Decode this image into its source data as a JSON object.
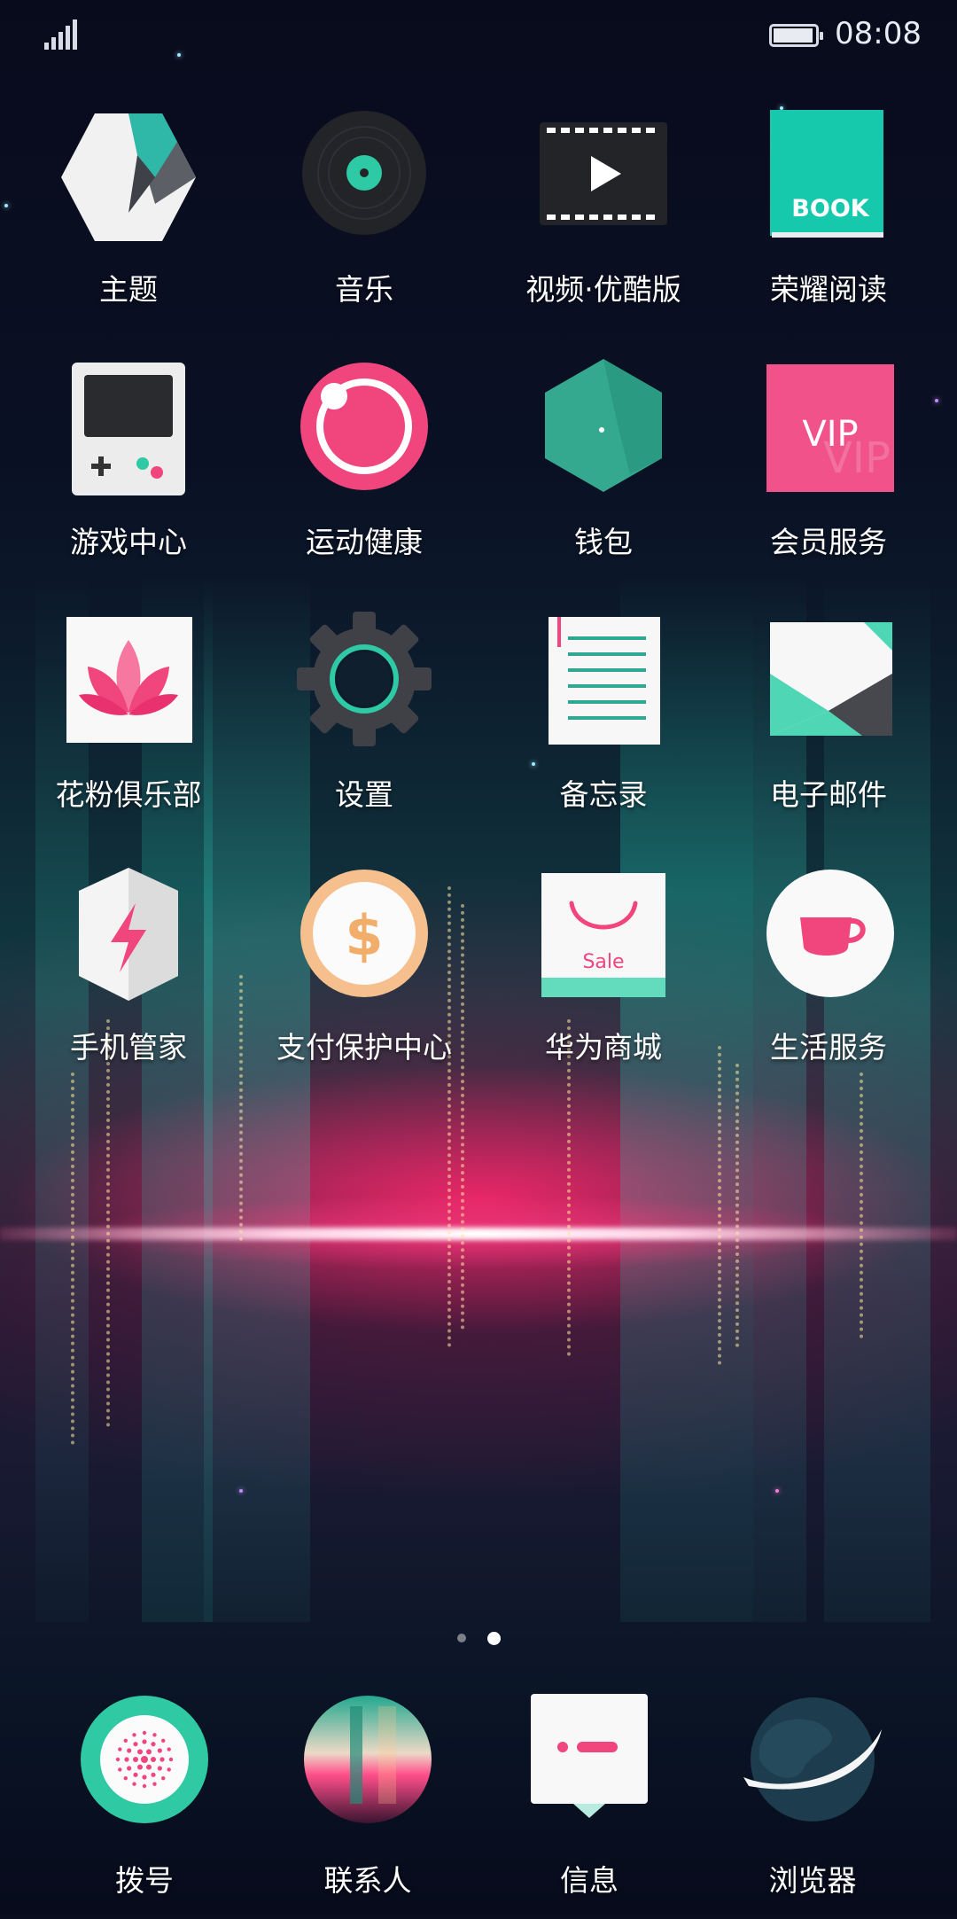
{
  "status_bar": {
    "time": "08:08",
    "signal_icon": "signal-icon",
    "battery_icon": "battery-icon",
    "battery_level": 0.95
  },
  "home_screen": {
    "apps": [
      {
        "label": "主题",
        "icon": "theme-icon"
      },
      {
        "label": "音乐",
        "icon": "music-icon"
      },
      {
        "label": "视频·优酷版",
        "icon": "video-icon"
      },
      {
        "label": "荣耀阅读",
        "icon": "book-icon",
        "icon_text": "BOOK"
      },
      {
        "label": "游戏中心",
        "icon": "game-center-icon"
      },
      {
        "label": "运动健康",
        "icon": "health-icon"
      },
      {
        "label": "钱包",
        "icon": "wallet-icon"
      },
      {
        "label": "会员服务",
        "icon": "vip-icon",
        "icon_text": "VIP"
      },
      {
        "label": "花粉俱乐部",
        "icon": "club-icon"
      },
      {
        "label": "设置",
        "icon": "settings-icon"
      },
      {
        "label": "备忘录",
        "icon": "notepad-icon"
      },
      {
        "label": "电子邮件",
        "icon": "email-icon"
      },
      {
        "label": "手机管家",
        "icon": "phone-manager-icon"
      },
      {
        "label": "支付保护中心",
        "icon": "payment-protect-icon",
        "icon_text": "$"
      },
      {
        "label": "华为商城",
        "icon": "shop-icon",
        "icon_text": "Sale"
      },
      {
        "label": "生活服务",
        "icon": "life-service-icon"
      }
    ],
    "page_indicator": {
      "pages": 2,
      "current": 2
    }
  },
  "dock": {
    "apps": [
      {
        "label": "拨号",
        "icon": "dialer-icon"
      },
      {
        "label": "联系人",
        "icon": "contacts-icon"
      },
      {
        "label": "信息",
        "icon": "messages-icon"
      },
      {
        "label": "浏览器",
        "icon": "browser-icon"
      }
    ]
  },
  "colors": {
    "accent_teal": "#2ec9a5",
    "accent_pink": "#f0457d",
    "background": "#090d1e"
  }
}
